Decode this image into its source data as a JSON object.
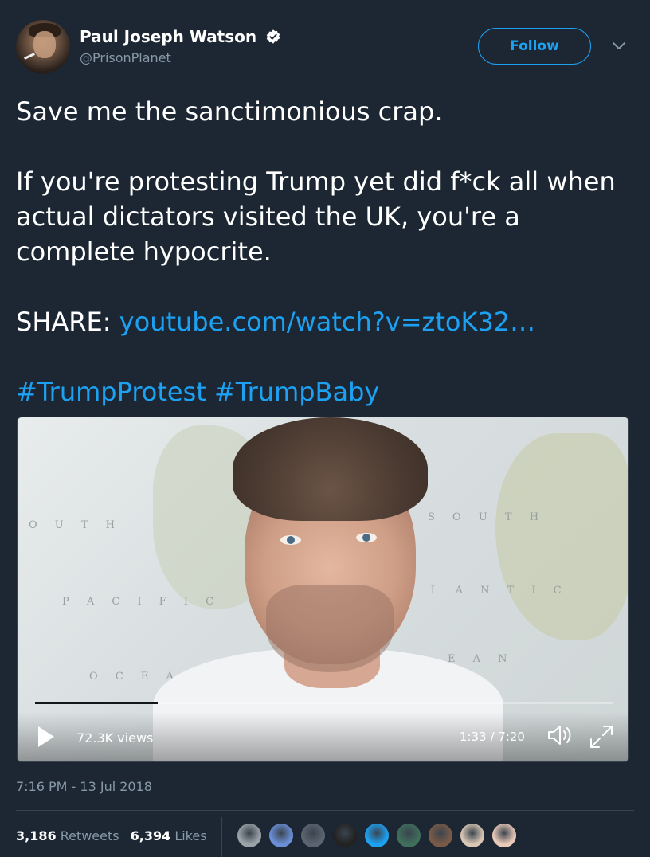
{
  "tweet": {
    "author": {
      "display_name": "Paul Joseph Watson",
      "handle": "@PrisonPlanet",
      "verified": true
    },
    "follow_label": "Follow",
    "text": {
      "line1": "Save me the sanctimonious crap.",
      "para2": "If you're protesting Trump yet did f*ck all when actual dictators visited the UK, you're a complete hypocrite.",
      "share_prefix": "SHARE: ",
      "share_link": "youtube.com/watch?v=ztoK32…",
      "hashtags": "#TrumpProtest #TrumpBaby"
    },
    "media": {
      "map_labels": {
        "left_top": "O U T H",
        "right_top": "S O U T H",
        "pacific": "P A C I F I C",
        "atlantic": "T L A N T I C",
        "ocean_left": "O C E A N",
        "ocean_right": "E A N"
      },
      "views": "72.3K views",
      "time": "1:33 / 7:20",
      "progress_fraction": 0.212,
      "icons": [
        "play-icon",
        "volume-icon",
        "fullscreen-icon"
      ]
    },
    "timestamp": "7:16 PM - 13 Jul 2018",
    "stats": {
      "retweets_count": "3,186",
      "retweets_label": "Retweets",
      "likes_count": "6,394",
      "likes_label": "Likes"
    },
    "liker_avatar_colors": [
      "#9aa3a8",
      "#6a8fd6",
      "#5b6470",
      "#222222",
      "#1da1f2",
      "#3f6e5b",
      "#7a5a46",
      "#d8c7b5",
      "#e9c9b8"
    ]
  },
  "colors": {
    "background": "#1c2733",
    "accent": "#1da1f2",
    "secondary_text": "#8899a6"
  }
}
